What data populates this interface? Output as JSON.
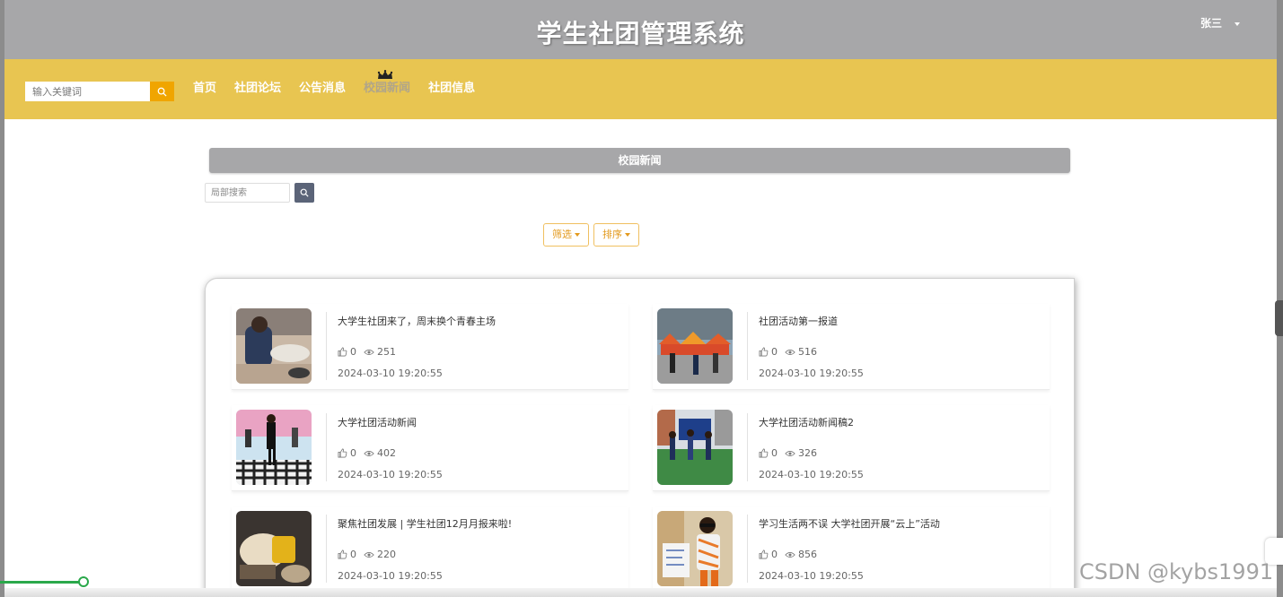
{
  "header": {
    "title": "学生社团管理系统",
    "user_name": "张三"
  },
  "navbar": {
    "search_placeholder": "输入关键词",
    "items": [
      {
        "label": "首页",
        "active": false
      },
      {
        "label": "社团论坛",
        "active": false
      },
      {
        "label": "公告消息",
        "active": false
      },
      {
        "label": "校园新闻",
        "active": true
      },
      {
        "label": "社团信息",
        "active": false
      }
    ]
  },
  "section": {
    "title": "校园新闻",
    "local_search_placeholder": "局部搜索",
    "filter_label": "筛选",
    "sort_label": "排序"
  },
  "news": [
    {
      "title": "大学生社团来了，周末换个青春主场",
      "likes": "0",
      "views": "251",
      "date": "2024-03-10 19:20:55"
    },
    {
      "title": "社团活动第一报道",
      "likes": "0",
      "views": "516",
      "date": "2024-03-10 19:20:55"
    },
    {
      "title": "大学社团活动新闻",
      "likes": "0",
      "views": "402",
      "date": "2024-03-10 19:20:55"
    },
    {
      "title": "大学社团活动新闻稿2",
      "likes": "0",
      "views": "326",
      "date": "2024-03-10 19:20:55"
    },
    {
      "title": "聚焦社团发展 | 学生社团12月月报来啦!",
      "likes": "0",
      "views": "220",
      "date": "2024-03-10 19:20:55"
    },
    {
      "title": "学习生活两不误 大学社团开展“云上”活动",
      "likes": "0",
      "views": "856",
      "date": "2024-03-10 19:20:55"
    }
  ],
  "watermark": "CSDN @kybs1991",
  "colors": {
    "header": "#a7a7a9",
    "navbar": "#e8c551",
    "accent": "#f0a500"
  }
}
